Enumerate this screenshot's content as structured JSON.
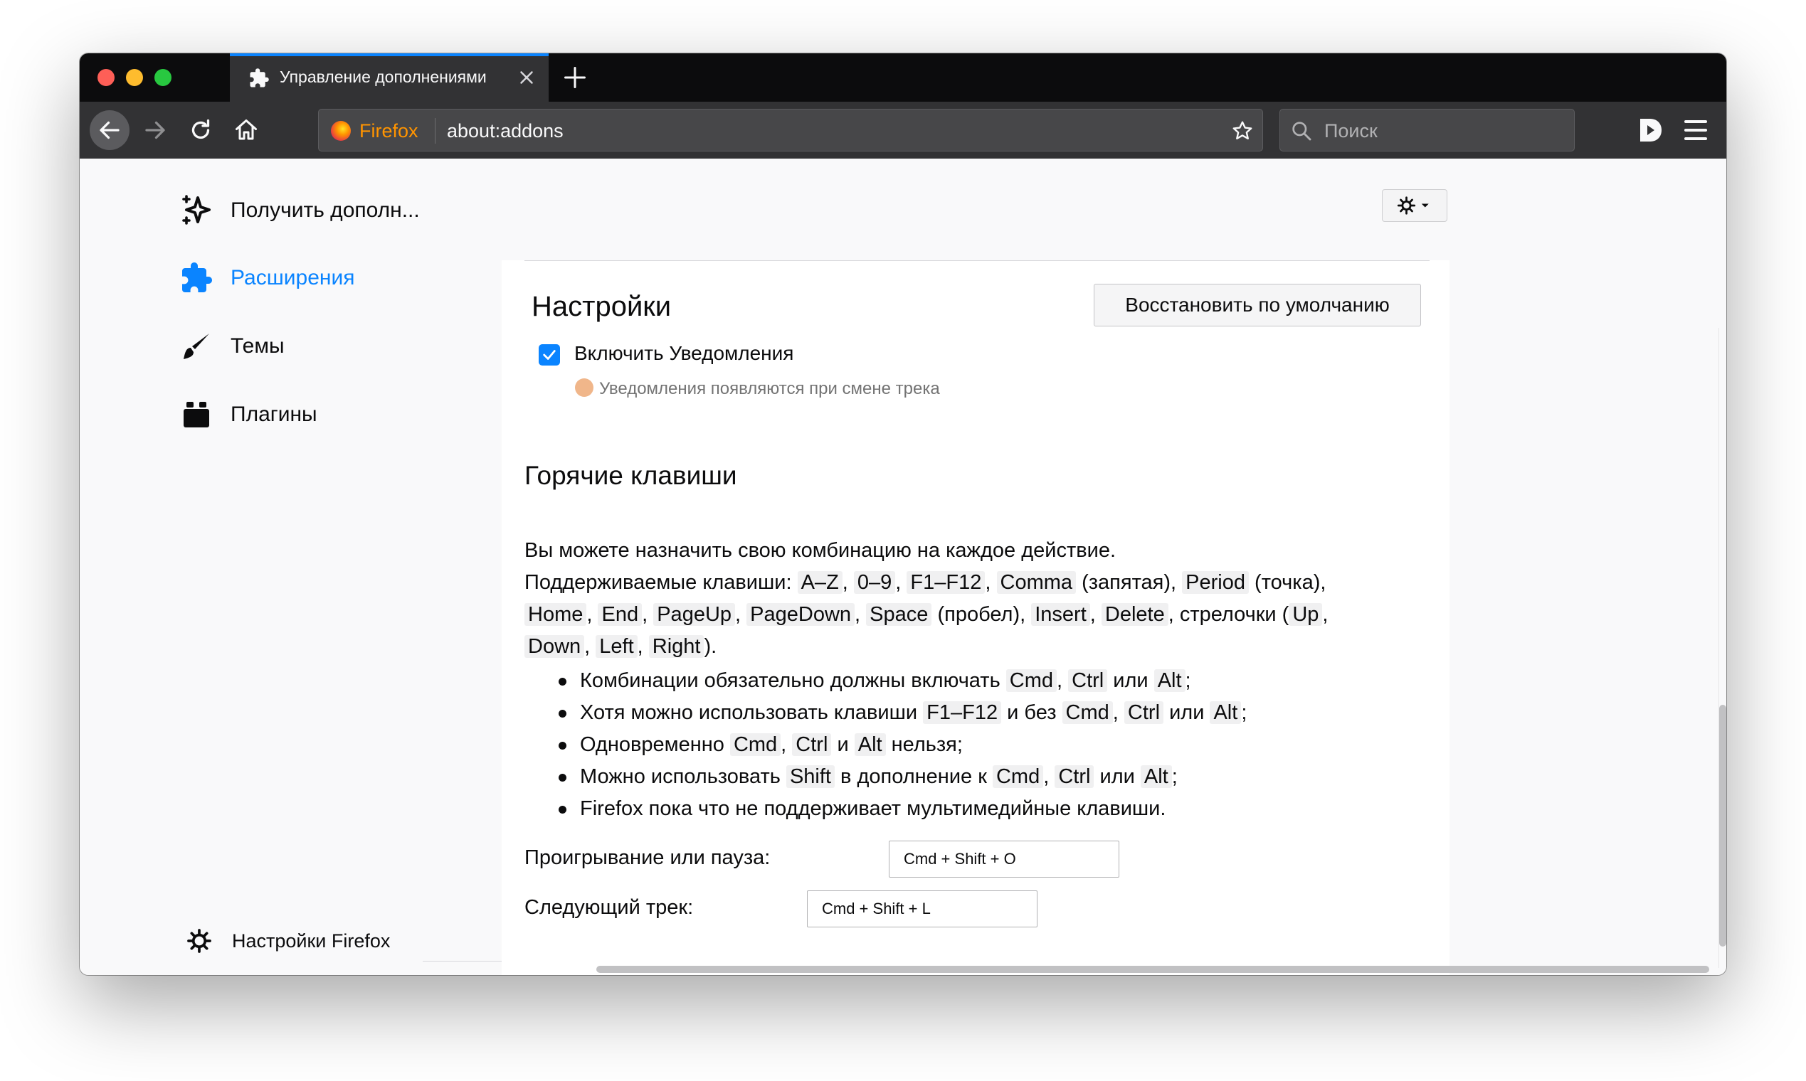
{
  "tab": {
    "title": "Управление дополнениями",
    "icon": "puzzle-icon"
  },
  "toolbar": {
    "identity_label": "Firefox",
    "url": "about:addons",
    "search_placeholder": "Поиск"
  },
  "sidebar": {
    "items": [
      {
        "label": "Получить дополн...",
        "icon": "sparkle-icon",
        "selected": false
      },
      {
        "label": "Расширения",
        "icon": "puzzle-icon",
        "selected": true
      },
      {
        "label": "Темы",
        "icon": "brush-icon",
        "selected": false
      },
      {
        "label": "Плагины",
        "icon": "plugin-icon",
        "selected": false
      }
    ],
    "footer_label": "Настройки Firefox"
  },
  "settings": {
    "title": "Настройки",
    "restore_button": "Восстановить по умолчанию",
    "notifications_checkbox_label": "Включить Уведомления",
    "notifications_checked": true,
    "notifications_note": "Уведомления появляются при смене трека"
  },
  "hotkeys": {
    "title": "Горячие клавиши",
    "intro_line1": "Вы можете назначить свою комбинацию на каждое действие.",
    "supported_prefix": "Поддерживаемые клавиши:",
    "keys": [
      "A–Z",
      "0–9",
      "F1–F12",
      "Comma",
      "Period",
      "Home",
      "End",
      "PageUp",
      "PageDown",
      "Space",
      "Insert",
      "Delete",
      "Up",
      "Down",
      "Left",
      "Right"
    ],
    "comma_note": "(запятая),",
    "period_note": "(точка),",
    "space_note": "(пробел),",
    "arrows_text": ", стрелочки (",
    "closing_text": ").",
    "rules": {
      "r1_text": "Комбинации обязательно должны включать",
      "r1_or": "или",
      "r2_text": "Хотя можно использовать клавиши",
      "r2_without": "и без",
      "r2_or": "или",
      "r3_text": "Одновременно",
      "r3_and": "и",
      "r3_not": "нельзя;",
      "r4_text": "Можно использовать",
      "r4_in_addition": "в дополнение к",
      "r4_or": "или",
      "r5_text": "Firefox пока что не поддерживает мультимедийные клавиши.",
      "mod_cmd": "Cmd",
      "mod_ctrl": "Ctrl",
      "mod_alt": "Alt",
      "mod_shift": "Shift",
      "mod_f": "F1–F12"
    },
    "play_pause_label": "Проигрывание или пауза:",
    "play_pause_value": "Cmd + Shift + O",
    "next_track_label": "Следующий трек:",
    "next_track_value": "Cmd + Shift + L"
  },
  "colors": {
    "accent": "#0a84ff",
    "tabbar": "#0c0c0d",
    "navbar": "#323234"
  }
}
